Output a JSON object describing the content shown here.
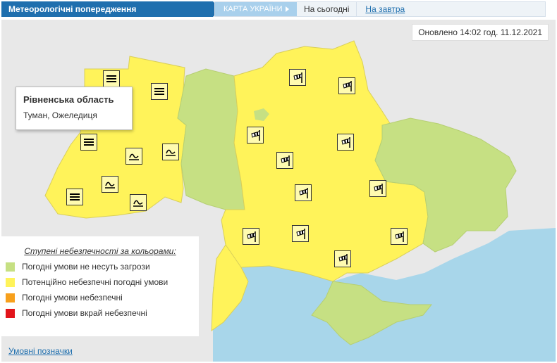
{
  "header": {
    "title": "Метеорологічні попередження",
    "tab_map": "КАРТА УКРАЇНИ",
    "tab_today": "На сьогодні",
    "tab_tomorrow": "На завтра"
  },
  "updated": "Оновлено 14:02 год. 11.12.2021",
  "tooltip": {
    "region": "Рівненська область",
    "phenomena": "Туман, Ожеледиця"
  },
  "legend": {
    "heading": "Ступені небезпечності за кольорами:",
    "items": [
      {
        "label": "Погодні умови не несуть загрози",
        "color": "#c6e083"
      },
      {
        "label": "Потенційно небезпечні погодні умови",
        "color": "#fff35a"
      },
      {
        "label": "Погодні умови небезпечні",
        "color": "#f7a01c"
      },
      {
        "label": "Погодні умови вкрай небезпечні",
        "color": "#e2141b"
      }
    ],
    "link": "Умовні позначки"
  },
  "colors": {
    "yellow": "#fff35a",
    "green": "#c6e083",
    "sea": "#a8d6ea",
    "land": "#e8e8e8",
    "brand": "#1f6fae"
  },
  "icons": {
    "fog": "fog-icon",
    "ice": "ice-icon",
    "wind": "wind-sock-icon"
  }
}
